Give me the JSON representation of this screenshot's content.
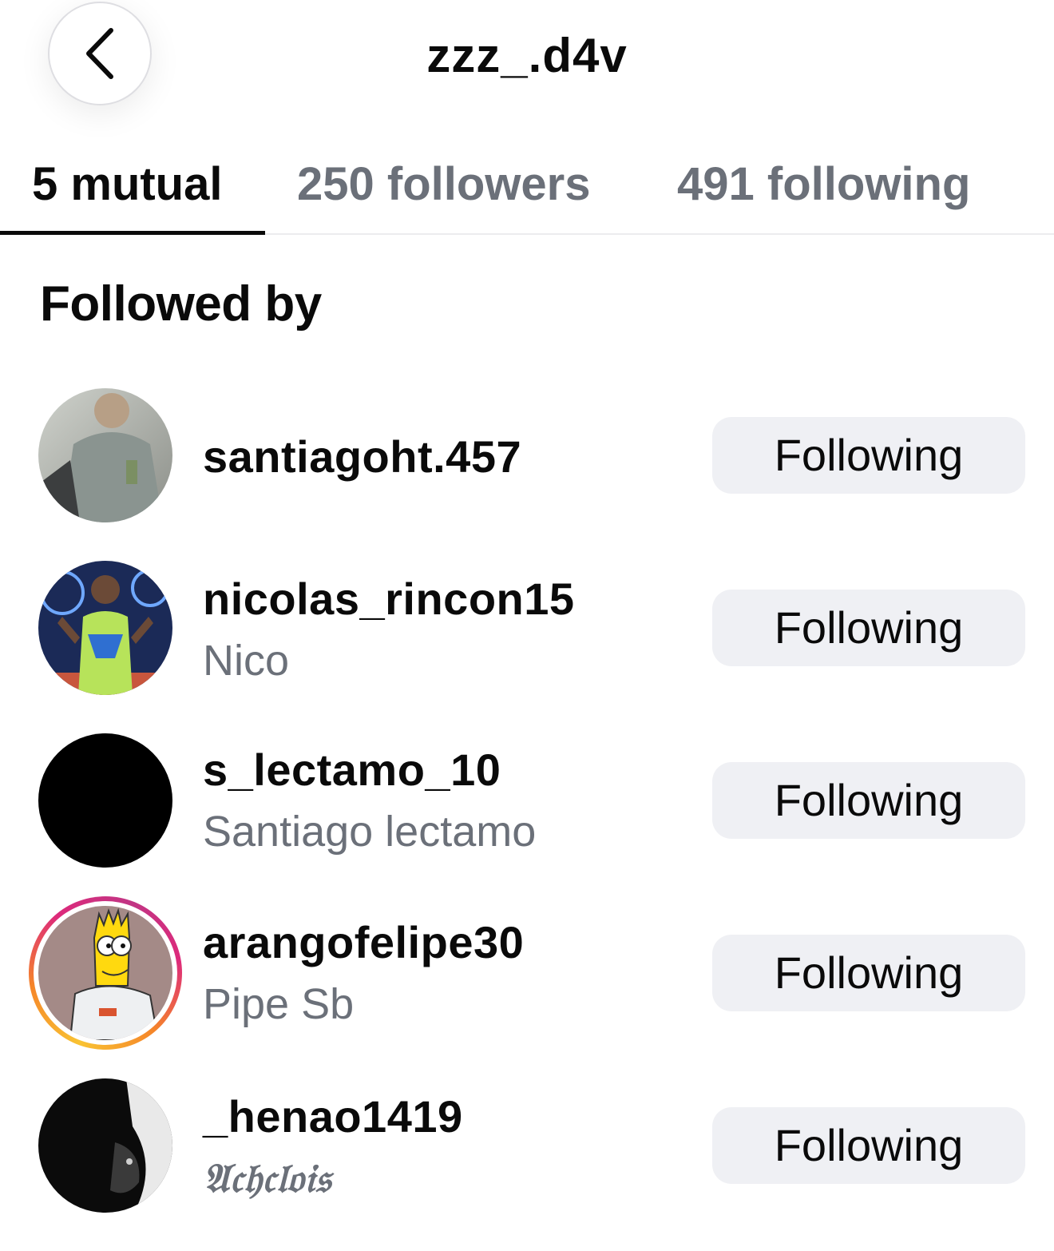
{
  "header": {
    "title": "zzz_.d4v",
    "back_icon": "chevron-left-icon"
  },
  "tabs": [
    {
      "label": "5 mutual",
      "active": true
    },
    {
      "label": "250 followers",
      "active": false
    },
    {
      "label": "491 following",
      "active": false
    }
  ],
  "section": {
    "title": "Followed by"
  },
  "users": [
    {
      "username": "santiagoht.457",
      "full_name": "",
      "button": "Following",
      "story_ring": false
    },
    {
      "username": "nicolas_rincon15",
      "full_name": "Nico",
      "button": "Following",
      "story_ring": false
    },
    {
      "username": "s_lectamo_10",
      "full_name": "Santiago lectamo",
      "button": "Following",
      "story_ring": false
    },
    {
      "username": "arangofelipe30",
      "full_name": "Pipe Sb",
      "button": "Following",
      "story_ring": true
    },
    {
      "username": "_henao1419",
      "full_name": "𝔄𝔠𝔥𝔠𝔩𝔬𝔦𝔰",
      "button": "Following",
      "story_ring": false
    }
  ],
  "colors": {
    "text_primary": "#0a0a0a",
    "text_secondary": "#6b7079",
    "button_bg": "#eff0f4",
    "story_ring": [
      "#f9c333",
      "#f58529",
      "#dd2a7b",
      "#c13584"
    ]
  }
}
